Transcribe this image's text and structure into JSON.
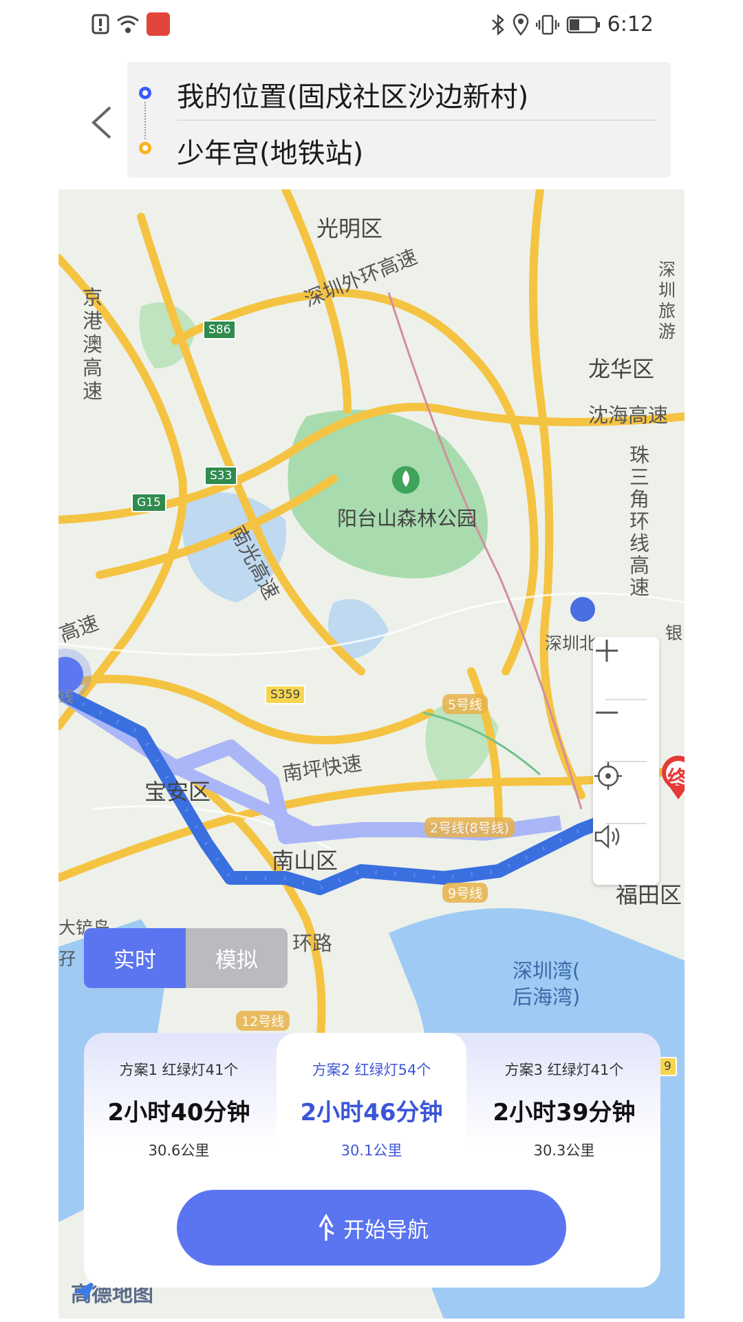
{
  "status_bar": {
    "time": "6:12"
  },
  "route": {
    "start": "我的位置(固戍社区沙边新村)",
    "end": "少年宫(地铁站)"
  },
  "map": {
    "labels": {
      "guangming": "光明区",
      "longhua": "龙华区",
      "baoan": "宝安区",
      "nanshan": "南山区",
      "futian": "福田区",
      "park": "阳台山森林公园",
      "bay": "深圳湾(",
      "bay2": "后海湾)",
      "outer_ring": "深圳外环高速",
      "shenhai": "沈海高速",
      "nanping": "南坪快速",
      "nanguang": "南光高速",
      "jinggangao": "京港澳高速",
      "zhusanjiao": "珠三角环线高速",
      "huanlu": "环路",
      "dachan": "大铲岛",
      "shenzhen_bei": "深圳北",
      "shenzhen_tour": "深圳旅游",
      "yin": "银",
      "end_marker": "终",
      "gaosu_left": "高速",
      "xian_left": "线",
      "zi": "孖"
    },
    "shields": {
      "s86": "S86",
      "s33": "S33",
      "g15": "G15",
      "s359": "S359",
      "r9": "9"
    },
    "metro_tags": {
      "line5": "5号线",
      "line2": "2号线(8号线)",
      "line9": "9号线",
      "line12": "12号线"
    },
    "logo": "高德地图"
  },
  "mode_toggle": {
    "realtime": "实时",
    "simulate": "模拟",
    "selected": "实时"
  },
  "plans": [
    {
      "head": "方案1  红绿灯41个",
      "time": "2小时40分钟",
      "distance": "30.6公里"
    },
    {
      "head": "方案2  红绿灯54个",
      "time": "2小时46分钟",
      "distance": "30.1公里"
    },
    {
      "head": "方案3  红绿灯41个",
      "time": "2小时39分钟",
      "distance": "30.3公里"
    }
  ],
  "selected_plan": 2,
  "start_nav": "开始导航",
  "colors": {
    "accent": "#5b74f0",
    "route": "#3a6fe0",
    "highway": "#f5b81d"
  }
}
